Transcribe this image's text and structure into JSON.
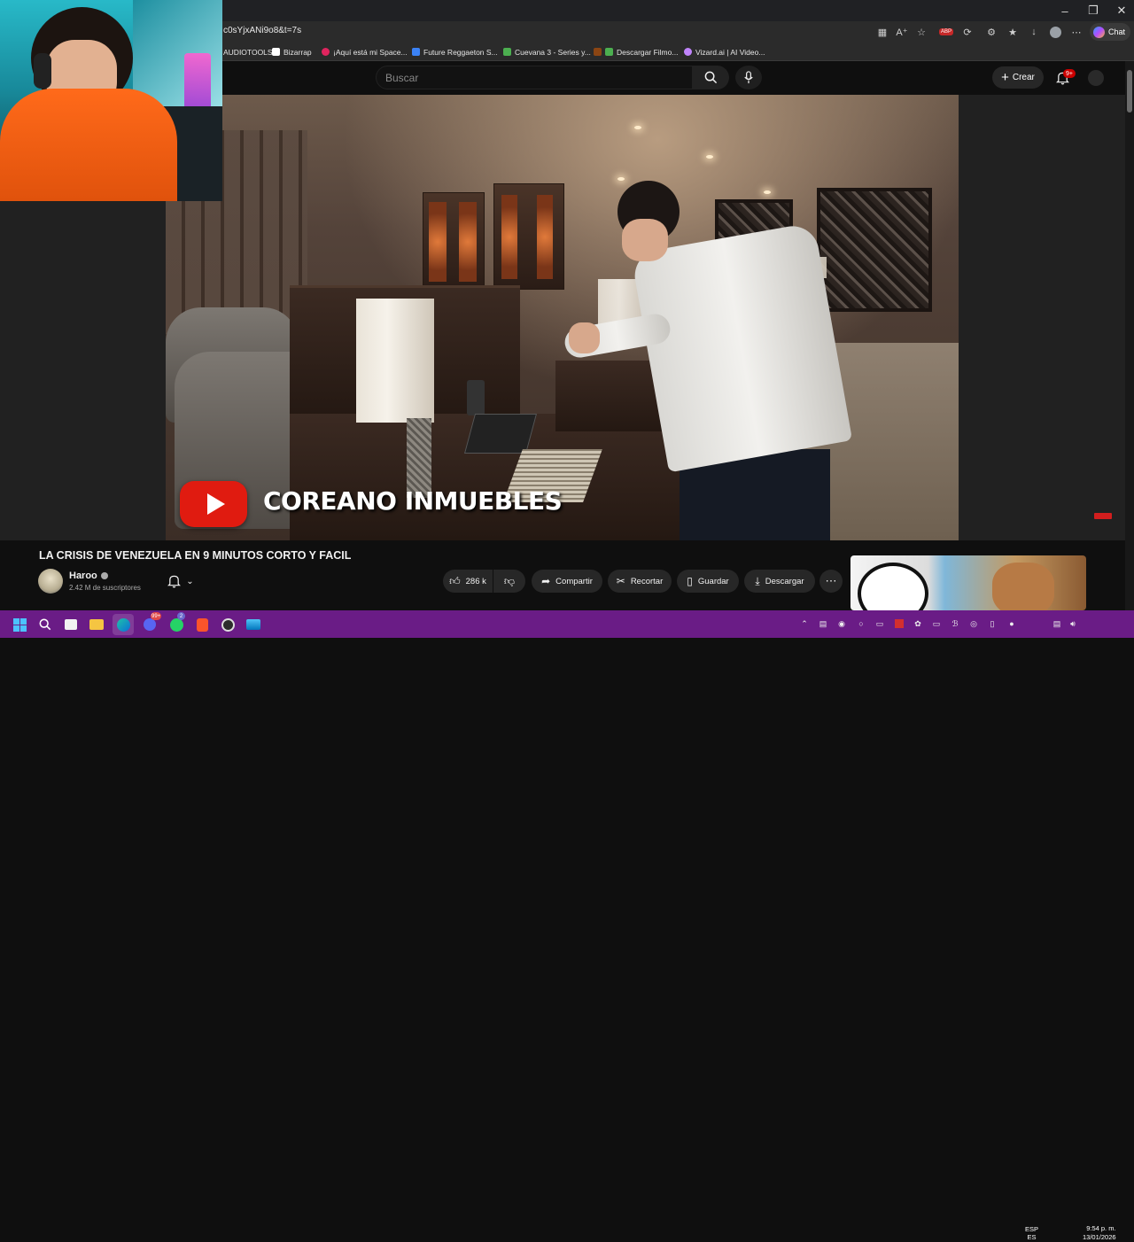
{
  "browser": {
    "url": "c0sYjxANi9o8&t=7s",
    "chat_label": "Chat",
    "bookmarks": [
      {
        "label": "AUDIOTOOLS",
        "color": "#444444"
      },
      {
        "label": "Bizarrap",
        "color": "#ffffff"
      },
      {
        "label": "¡Aquí está mi Space...",
        "color": "#e0245e"
      },
      {
        "label": "Future Reggaeton S...",
        "color": "#3b82f6"
      },
      {
        "label": "Cuevana 3 - Series y...",
        "color": "#4caf50"
      },
      {
        "label": "Descargar Filmo...",
        "color": "#4caf50"
      },
      {
        "label": "Vizard.ai | AI Video...",
        "color": "#c084fc"
      }
    ],
    "abp_badge": "ABP"
  },
  "youtube": {
    "search_placeholder": "Buscar",
    "create_label": "Crear",
    "notifications_badge": "9+",
    "video": {
      "watermark_text": "COREANO INMUEBLES",
      "title": "LA CRISIS DE VENEZUELA EN 9 MINUTOS CORTO Y FACIL"
    },
    "channel": {
      "name": "Haroo",
      "subscribers": "2.42 M de suscriptores"
    },
    "actions": {
      "likes": "286 k",
      "share": "Compartir",
      "clip": "Recortar",
      "save": "Guardar",
      "download": "Descargar"
    }
  },
  "taskbar": {
    "copilot_badge": "99+",
    "whatsapp_badge": "2",
    "language_line1": "ESP",
    "language_line2": "ES",
    "time": "9:54 p. m.",
    "date": "13/01/2026"
  },
  "colors": {
    "yt_background": "#0f0f0f",
    "taskbar": "#6a1c86",
    "yt_red": "#e01b10"
  }
}
